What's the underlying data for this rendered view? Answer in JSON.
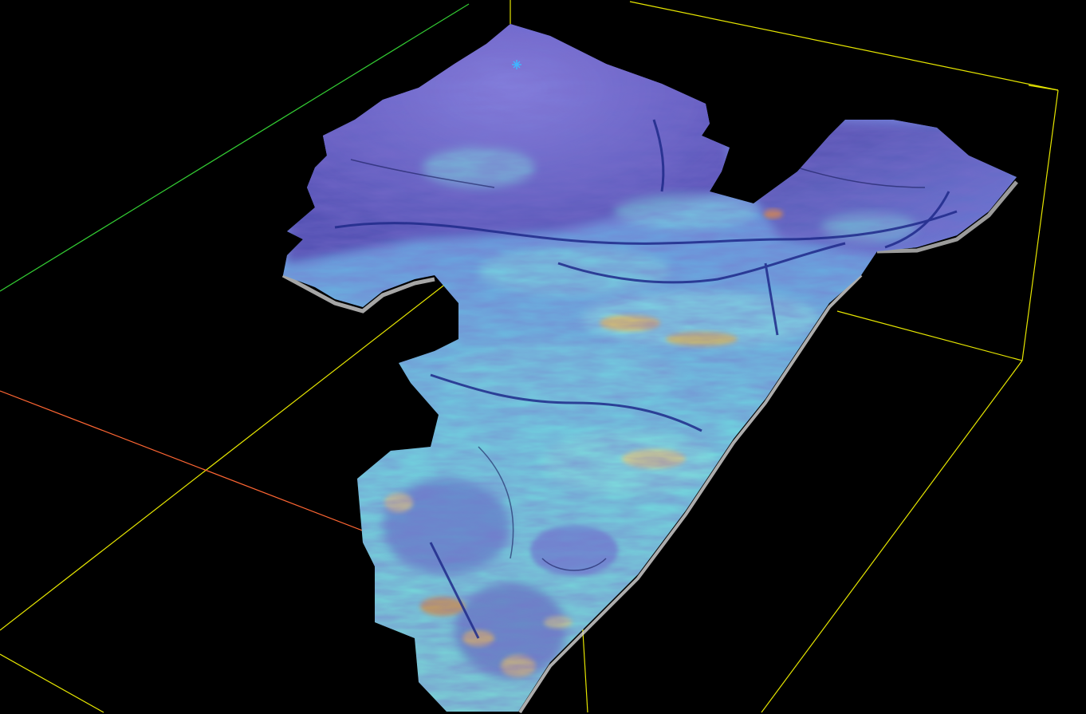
{
  "viewer": {
    "background_color": "#000000",
    "bounding_box_color": "#e6e600",
    "axis_x_color": "#ff6633",
    "axis_y_color": "#33cc33"
  },
  "surface": {
    "colormap": [
      "#2a1f7a",
      "#4b3fa8",
      "#6f6cd6",
      "#55c6e3",
      "#7fe7e0",
      "#e7e27a",
      "#e8a33c"
    ],
    "dominant_colors": [
      "#6f6cd6",
      "#55c6e3",
      "#e7d27a"
    ],
    "marker_color": "#3fb6ff",
    "marker_symbol": "*"
  }
}
